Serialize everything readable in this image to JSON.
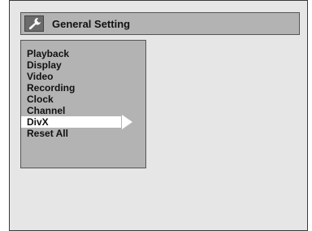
{
  "header": {
    "title": "General Setting",
    "icon": "wrench-icon"
  },
  "menu": {
    "items": [
      {
        "label": "Playback",
        "selected": false
      },
      {
        "label": "Display",
        "selected": false
      },
      {
        "label": "Video",
        "selected": false
      },
      {
        "label": "Recording",
        "selected": false
      },
      {
        "label": "Clock",
        "selected": false
      },
      {
        "label": "Channel",
        "selected": false
      },
      {
        "label": "DivX",
        "selected": true
      },
      {
        "label": "Reset All",
        "selected": false
      }
    ],
    "selected_arrow_icon": "arrow-right-icon"
  },
  "colors": {
    "screen_bg": "#e6e6e6",
    "panel_bg": "#b3b3b3",
    "highlight": "#ffffff",
    "text": "#111111"
  }
}
